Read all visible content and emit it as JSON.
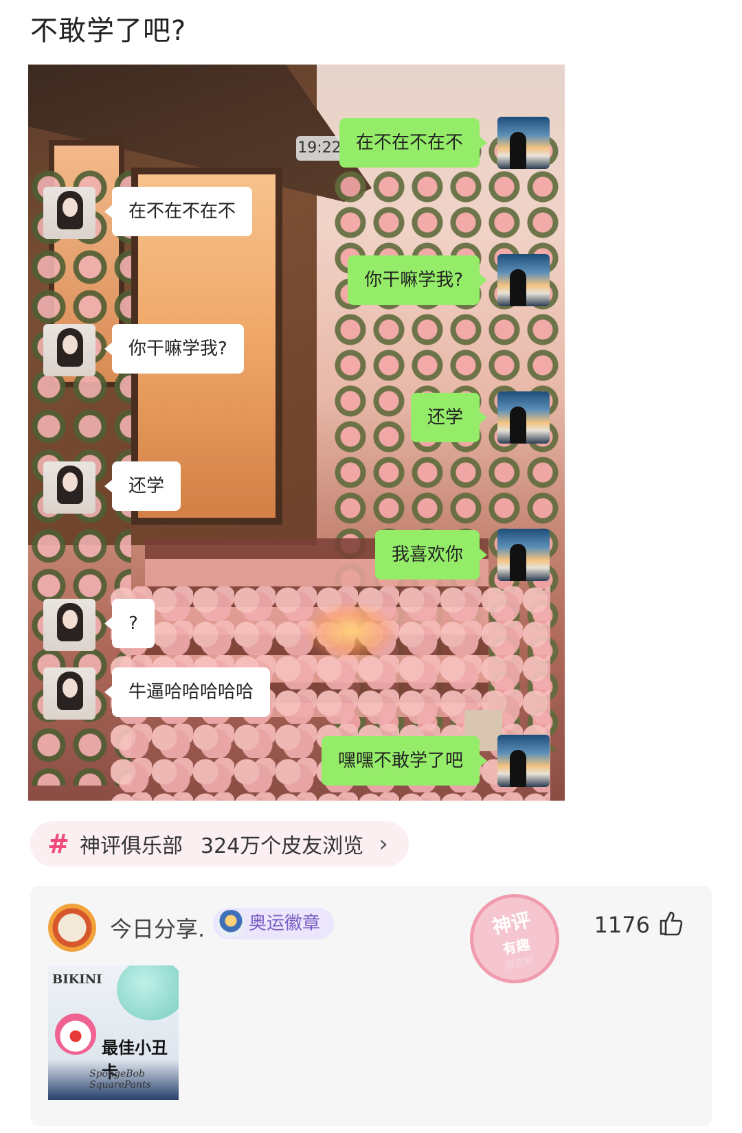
{
  "post": {
    "title": "不敢学了吧?"
  },
  "chat": {
    "time": "19:22",
    "messages": [
      {
        "side": "out",
        "text": "在不在不在不"
      },
      {
        "side": "in",
        "text": "在不在不在不"
      },
      {
        "side": "out",
        "text": "你干嘛学我?"
      },
      {
        "side": "in",
        "text": "你干嘛学我?"
      },
      {
        "side": "out",
        "text": "还学"
      },
      {
        "side": "in",
        "text": "还学"
      },
      {
        "side": "out",
        "text": "我喜欢你"
      },
      {
        "side": "in",
        "text": "?"
      },
      {
        "side": "in",
        "text": "牛逼哈哈哈哈哈"
      },
      {
        "side": "out",
        "text": "嘿嘿不敢学了吧"
      }
    ],
    "colors": {
      "bubble_out": "#95ec69",
      "bubble_in": "#ffffff"
    }
  },
  "topic": {
    "icon": "hash-icon",
    "name": "神评俱乐部",
    "views": "324万个皮友浏览",
    "chevron": "›",
    "accent": "#f04b7a"
  },
  "comment": {
    "username": "今日分享.",
    "badge": "奥运徽章",
    "likes": "1176",
    "stamp": {
      "line1": "神评",
      "line2": "有趣",
      "line3": "皮皮虾"
    },
    "image": {
      "top_text": "BIKINI",
      "caption": "最佳小丑卡",
      "signature": "SpongeBob SquarePants"
    }
  }
}
